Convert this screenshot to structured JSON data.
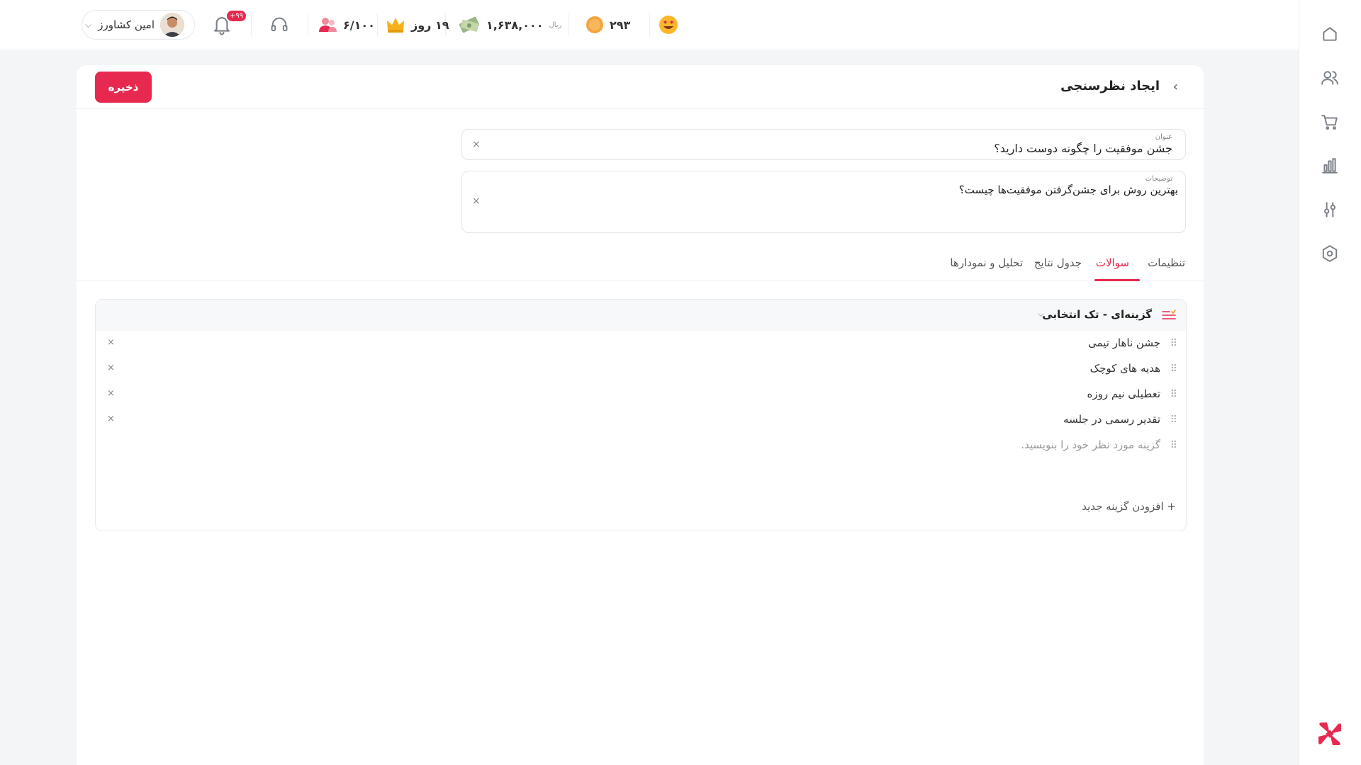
{
  "topbar": {
    "user_name": "امین کشاورز",
    "notifications_badge": "+۹۹",
    "members": "۶/۱۰۰",
    "days": "۱۹ روز",
    "balance": "۱,۶۳۸,۰۰۰",
    "currency": "ریال",
    "coins": "۲۹۳"
  },
  "page": {
    "title": "ایجاد نظرسنجی",
    "save_label": "ذخیره"
  },
  "form": {
    "title_label": "عنوان",
    "title_value": "جشن موفقیت را چگونه دوست دارید؟",
    "description_label": "توضیحات",
    "description_value": "بهترین روش برای جشن‌گرفتن موفقیت‌ها چیست؟"
  },
  "tabs": [
    "تنظیمات",
    "سوالات",
    "جدول نتایج",
    "تحلیل و نمودارها"
  ],
  "active_tab": "سوالات",
  "question": {
    "type_label": "گزینه‌ای - تک انتخابی",
    "options": [
      "جشن ناهار تیمی",
      "هدیه های کوچک",
      "تعطیلی نیم روزه",
      "تقدیر رسمی در جلسه"
    ],
    "new_option_placeholder": "گزینه مورد نظر خود را بنویسید.",
    "add_option_label": "افزودن گزینه جدید"
  },
  "colors": {
    "accent": "#e8294f"
  },
  "icons": {
    "sidebar": [
      "home-icon",
      "users-icon",
      "cart-icon",
      "chart-icon",
      "sliders-icon",
      "settings-icon"
    ]
  }
}
